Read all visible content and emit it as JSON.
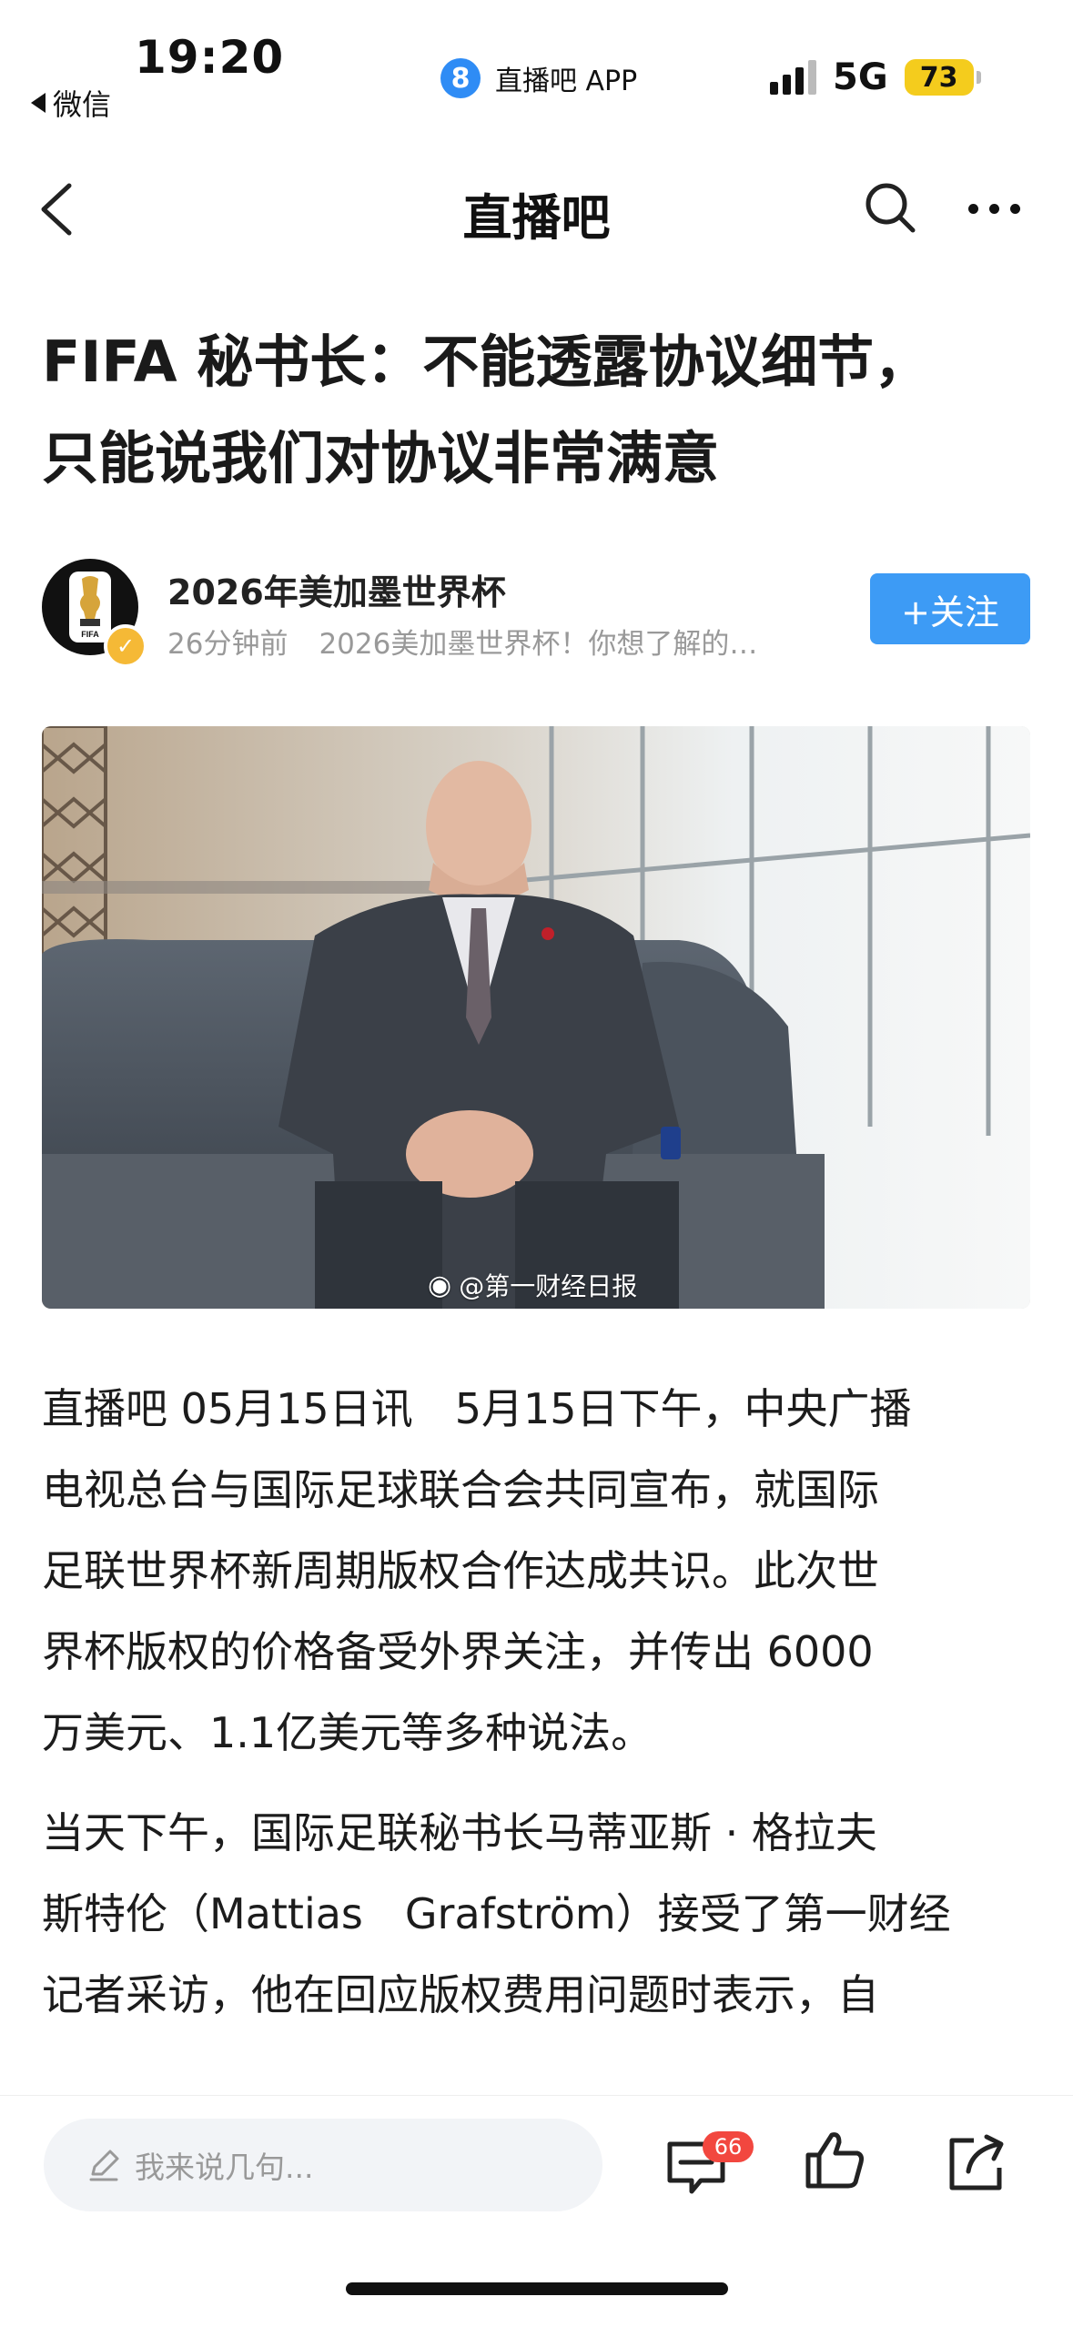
{
  "status_bar": {
    "time": "19:20",
    "back_app": "微信",
    "app_logo_glyph": "8",
    "app_name": "直播吧 APP",
    "network": "5G",
    "battery": "73"
  },
  "nav": {
    "title": "直播吧"
  },
  "article": {
    "title_lines": [
      "FIFA 秘书长：不能透露协议细节，",
      "只能说我们对协议非常满意"
    ],
    "author": {
      "name": "2026年美加墨世界杯",
      "time": "26分钟前",
      "bio": "2026美加墨世界杯！你想了解的…",
      "follow_label": "+关注"
    },
    "image_watermark": "@第一财经日报",
    "paragraphs": [
      [
        "直播吧 05月15日讯　5月15日下午，中央广播",
        "电视总台与国际足球联合会共同宣布，就国际",
        "足联世界杯新周期版权合作达成共识。此次世",
        "界杯版权的价格备受外界关注，并传出 6000",
        "万美元、1.1亿美元等多种说法。"
      ],
      [
        "当天下午，国际足联秘书长马蒂亚斯 · 格拉夫",
        "斯特伦（Mattias　Grafström）接受了第一财经",
        "记者采访，他在回应版权费用问题时表示，自"
      ]
    ]
  },
  "bottom_bar": {
    "comment_placeholder": "我来说几句...",
    "comment_count": "66"
  },
  "colors": {
    "accent": "#3d9bf5",
    "badge": "#f2473f",
    "battery": "#f4cc1d",
    "verify": "#f5b936"
  }
}
